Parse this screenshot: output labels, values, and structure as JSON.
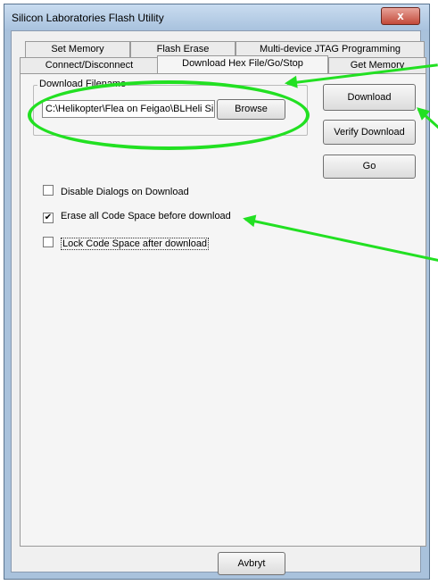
{
  "window": {
    "title": "Silicon Laboratories Flash Utility",
    "close_glyph": "x"
  },
  "tabs": {
    "row1": [
      "Set Memory",
      "Flash Erase",
      "Multi-device JTAG Programming"
    ],
    "row2": [
      "Connect/Disconnect",
      "Download Hex File/Go/Stop",
      "Get Memory"
    ]
  },
  "download": {
    "group_label": "Download Filename",
    "filename": "C:\\Helikopter\\Flea on Feigao\\BLHeli SiLa",
    "browse_label": "Browse"
  },
  "buttons": {
    "download": "Download",
    "verify": "Verify Download",
    "go": "Go",
    "cancel": "Avbryt"
  },
  "options": [
    {
      "label": "Disable Dialogs on Download",
      "checked": false
    },
    {
      "label": "Erase all Code Space before download",
      "checked": true
    },
    {
      "label": "Lock Code Space after download",
      "checked": false
    }
  ],
  "colors": {
    "annotation": "#22e022"
  }
}
